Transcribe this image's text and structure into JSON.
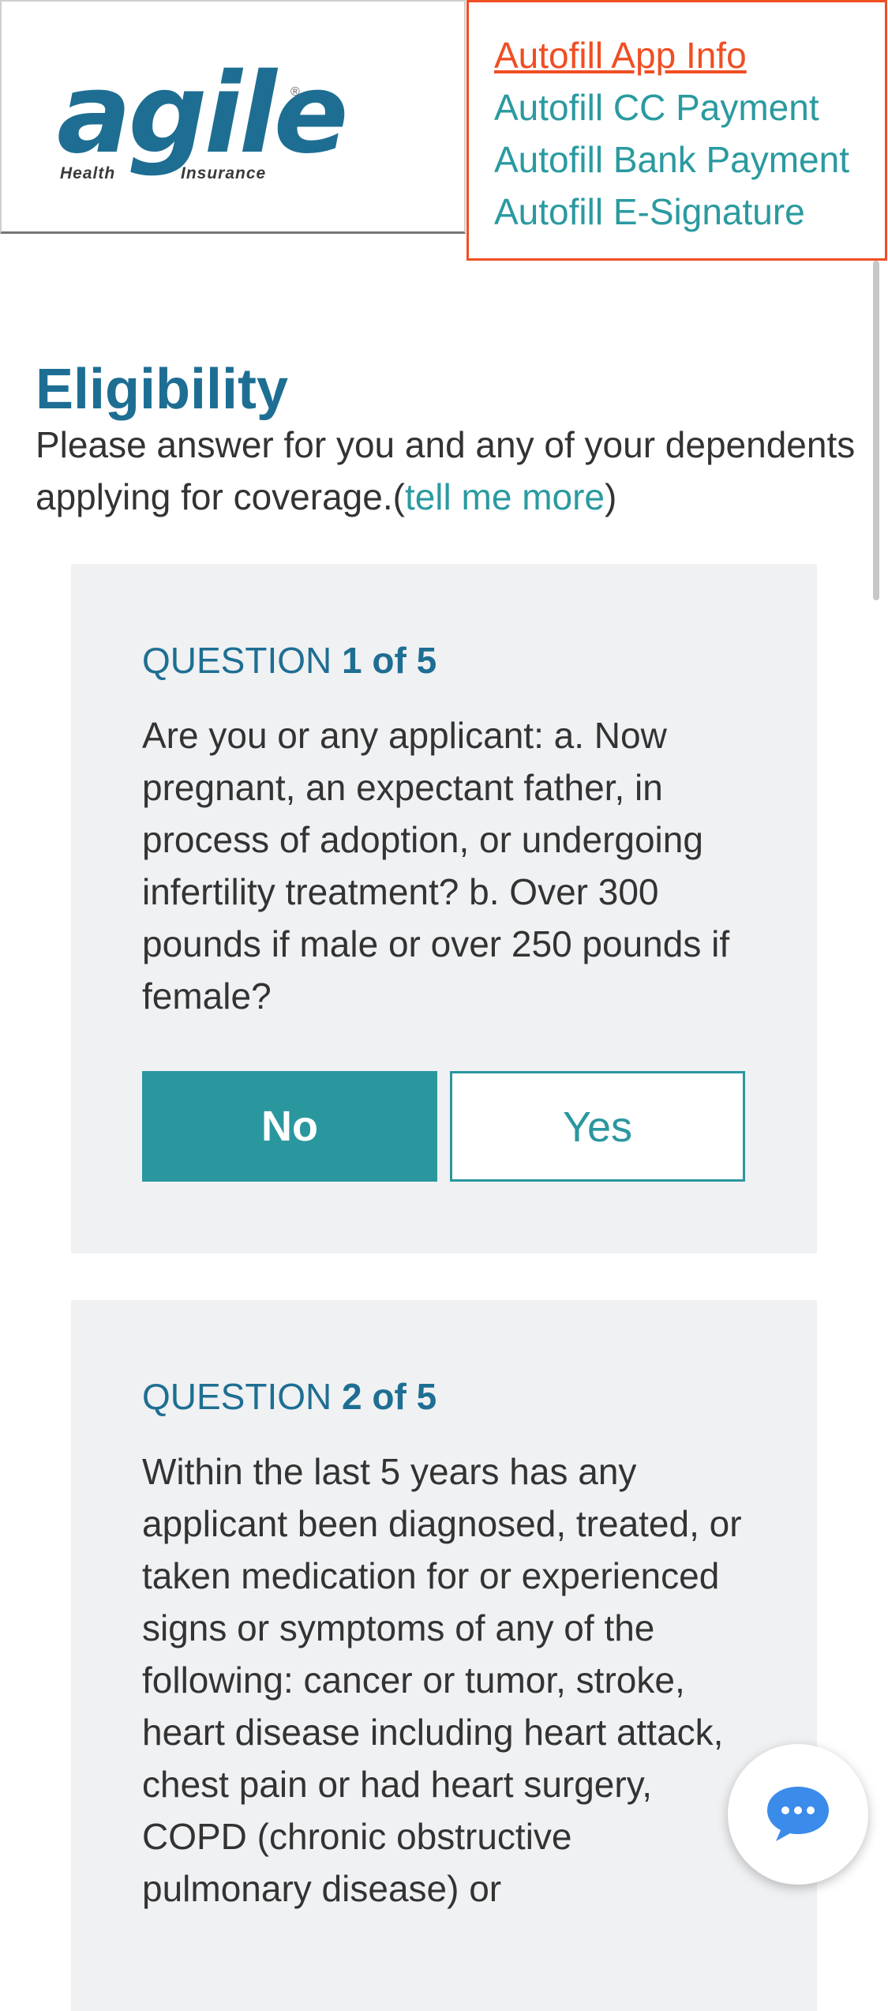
{
  "logo": {
    "word": "agile",
    "reg": "®",
    "sub_left": "Health",
    "sub_right": "Insurance"
  },
  "autofill": {
    "items": [
      {
        "label": "Autofill App Info"
      },
      {
        "label": "Autofill CC Payment"
      },
      {
        "label": "Autofill Bank Payment"
      },
      {
        "label": "Autofill E-Signature"
      }
    ]
  },
  "page": {
    "title": "Eligibility",
    "intro": "Please answer for you and any of your dependents applying for coverage.(",
    "intro_link": "tell me more",
    "intro_end": ")"
  },
  "questions": [
    {
      "label_prefix": "QUESTION ",
      "label_num": "1 of 5",
      "text": "Are you or any applicant: a. Now pregnant, an expectant father, in process of adoption, or undergoing infertility treatment? b. Over 300 pounds if male or over 250 pounds if female?",
      "no_label": "No",
      "yes_label": "Yes"
    },
    {
      "label_prefix": "QUESTION ",
      "label_num": "2 of 5",
      "text": "Within the last 5 years has any applicant been diagnosed, treated, or taken medication for or experienced signs or symptoms of any of the following: cancer or tumor, stroke, heart disease including heart attack, chest pain or had heart surgery, COPD (chronic obstructive pulmonary disease) or"
    }
  ],
  "colors": {
    "brand": "#1e6e93",
    "accent": "#2a979f",
    "autofill_active": "#f04e23",
    "card_bg": "#f0f1f3",
    "chat_icon": "#3b8bea"
  },
  "icons": {
    "chat": "chat-bubble-icon"
  }
}
